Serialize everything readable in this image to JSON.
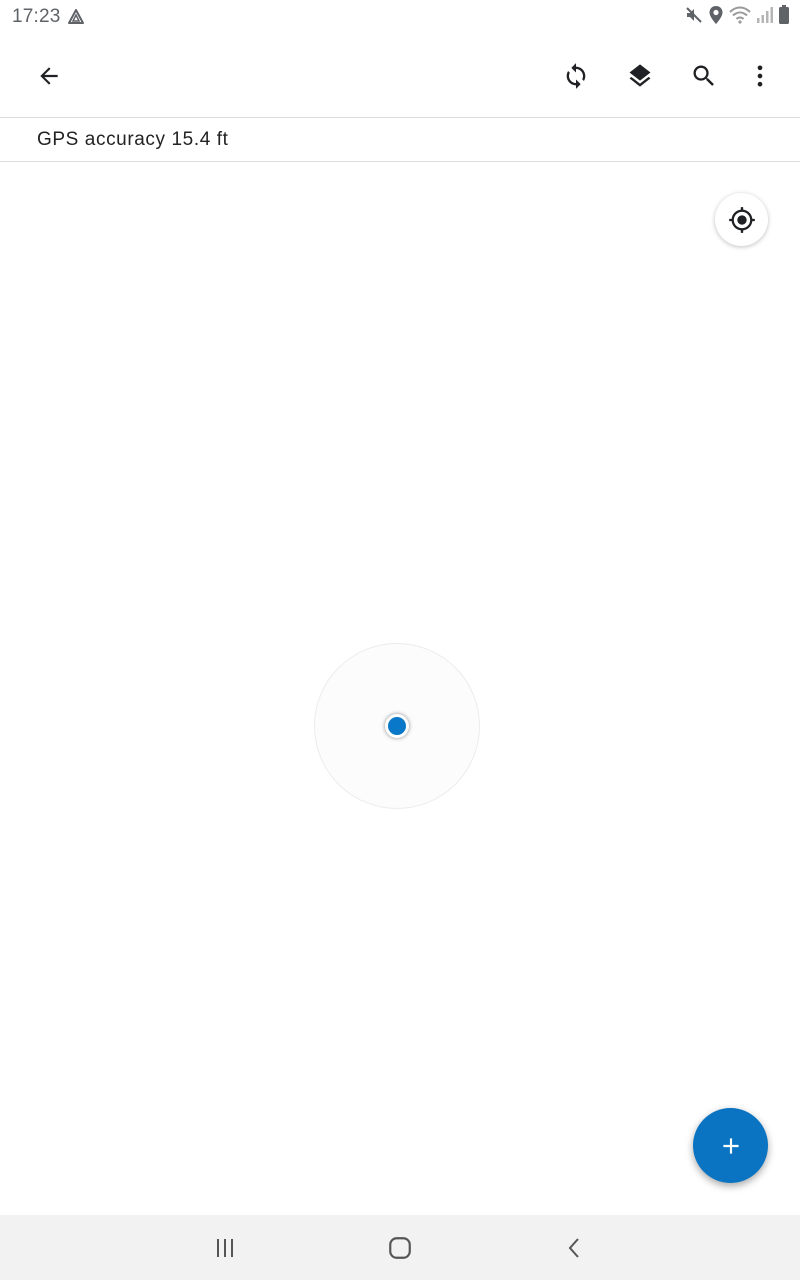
{
  "status_bar": {
    "time": "17:23",
    "icons": [
      "drive-icon",
      "mute-icon",
      "location-icon",
      "wifi-icon",
      "signal-icon",
      "battery-icon"
    ]
  },
  "app_bar": {
    "icons": [
      "back-arrow-icon",
      "sync-icon",
      "layers-icon",
      "search-icon",
      "more-vert-icon"
    ]
  },
  "accuracy": {
    "text": "GPS accuracy 15.4 ft"
  },
  "map": {
    "accuracy_circle_visible": true,
    "location_dot_color": "#0a78c8",
    "locate_button_icon": "my-location-icon"
  },
  "fab": {
    "icon": "plus-icon",
    "color": "#0a74c2"
  },
  "nav_bar": {
    "icons": [
      "recents-icon",
      "home-icon",
      "nav-back-icon"
    ]
  }
}
